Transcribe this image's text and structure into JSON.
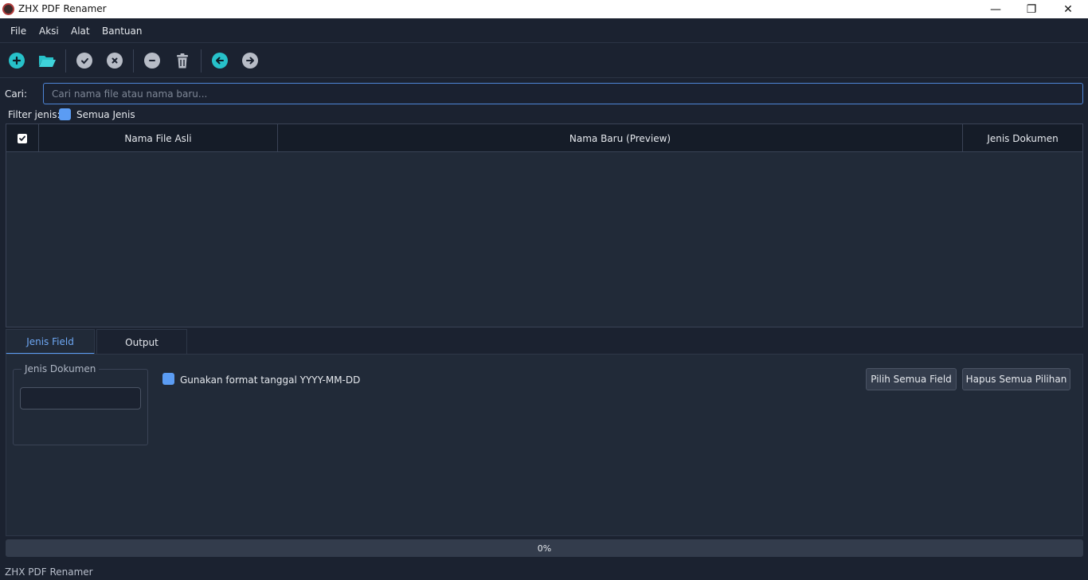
{
  "window": {
    "title": "ZHX PDF Renamer",
    "controls": {
      "minimize": "—",
      "restore": "❐",
      "close": "✕"
    }
  },
  "menu": [
    "File",
    "Aksi",
    "Alat",
    "Bantuan"
  ],
  "toolbar": {
    "icons": [
      "add-icon",
      "folder-open-icon",
      "check-icon",
      "x-icon",
      "minus-icon",
      "trash-icon",
      "arrow-left-icon",
      "arrow-right-icon"
    ],
    "accent_color": "#27c1c9",
    "muted_color": "#b7bcc6"
  },
  "search": {
    "label": "Cari:",
    "placeholder": "Cari nama file atau nama baru...",
    "value": ""
  },
  "filter": {
    "label": "Filter jenis:",
    "option": "Semua Jenis",
    "checked": true
  },
  "table": {
    "columns": [
      "Nama File Asli",
      "Nama Baru (Preview)",
      "Jenis Dokumen"
    ],
    "select_all_checked": true,
    "rows": []
  },
  "tabs": [
    {
      "label": "Jenis  Field",
      "active": true
    },
    {
      "label": "Output",
      "active": false
    }
  ],
  "field_panel": {
    "group_title": "Jenis Dokumen",
    "date_format_checkbox": "Gunakan format tanggal YYYY-MM-DD",
    "date_format_checked": true,
    "select_all_button": "Pilih Semua Field",
    "clear_button": "Hapus Semua Pilihan"
  },
  "progress": {
    "value": 0,
    "text": "0%"
  },
  "status": {
    "text": "ZHX PDF Renamer"
  },
  "colors": {
    "background": "#1b2230",
    "panel": "#212a38",
    "accent": "#5b9cf3"
  }
}
